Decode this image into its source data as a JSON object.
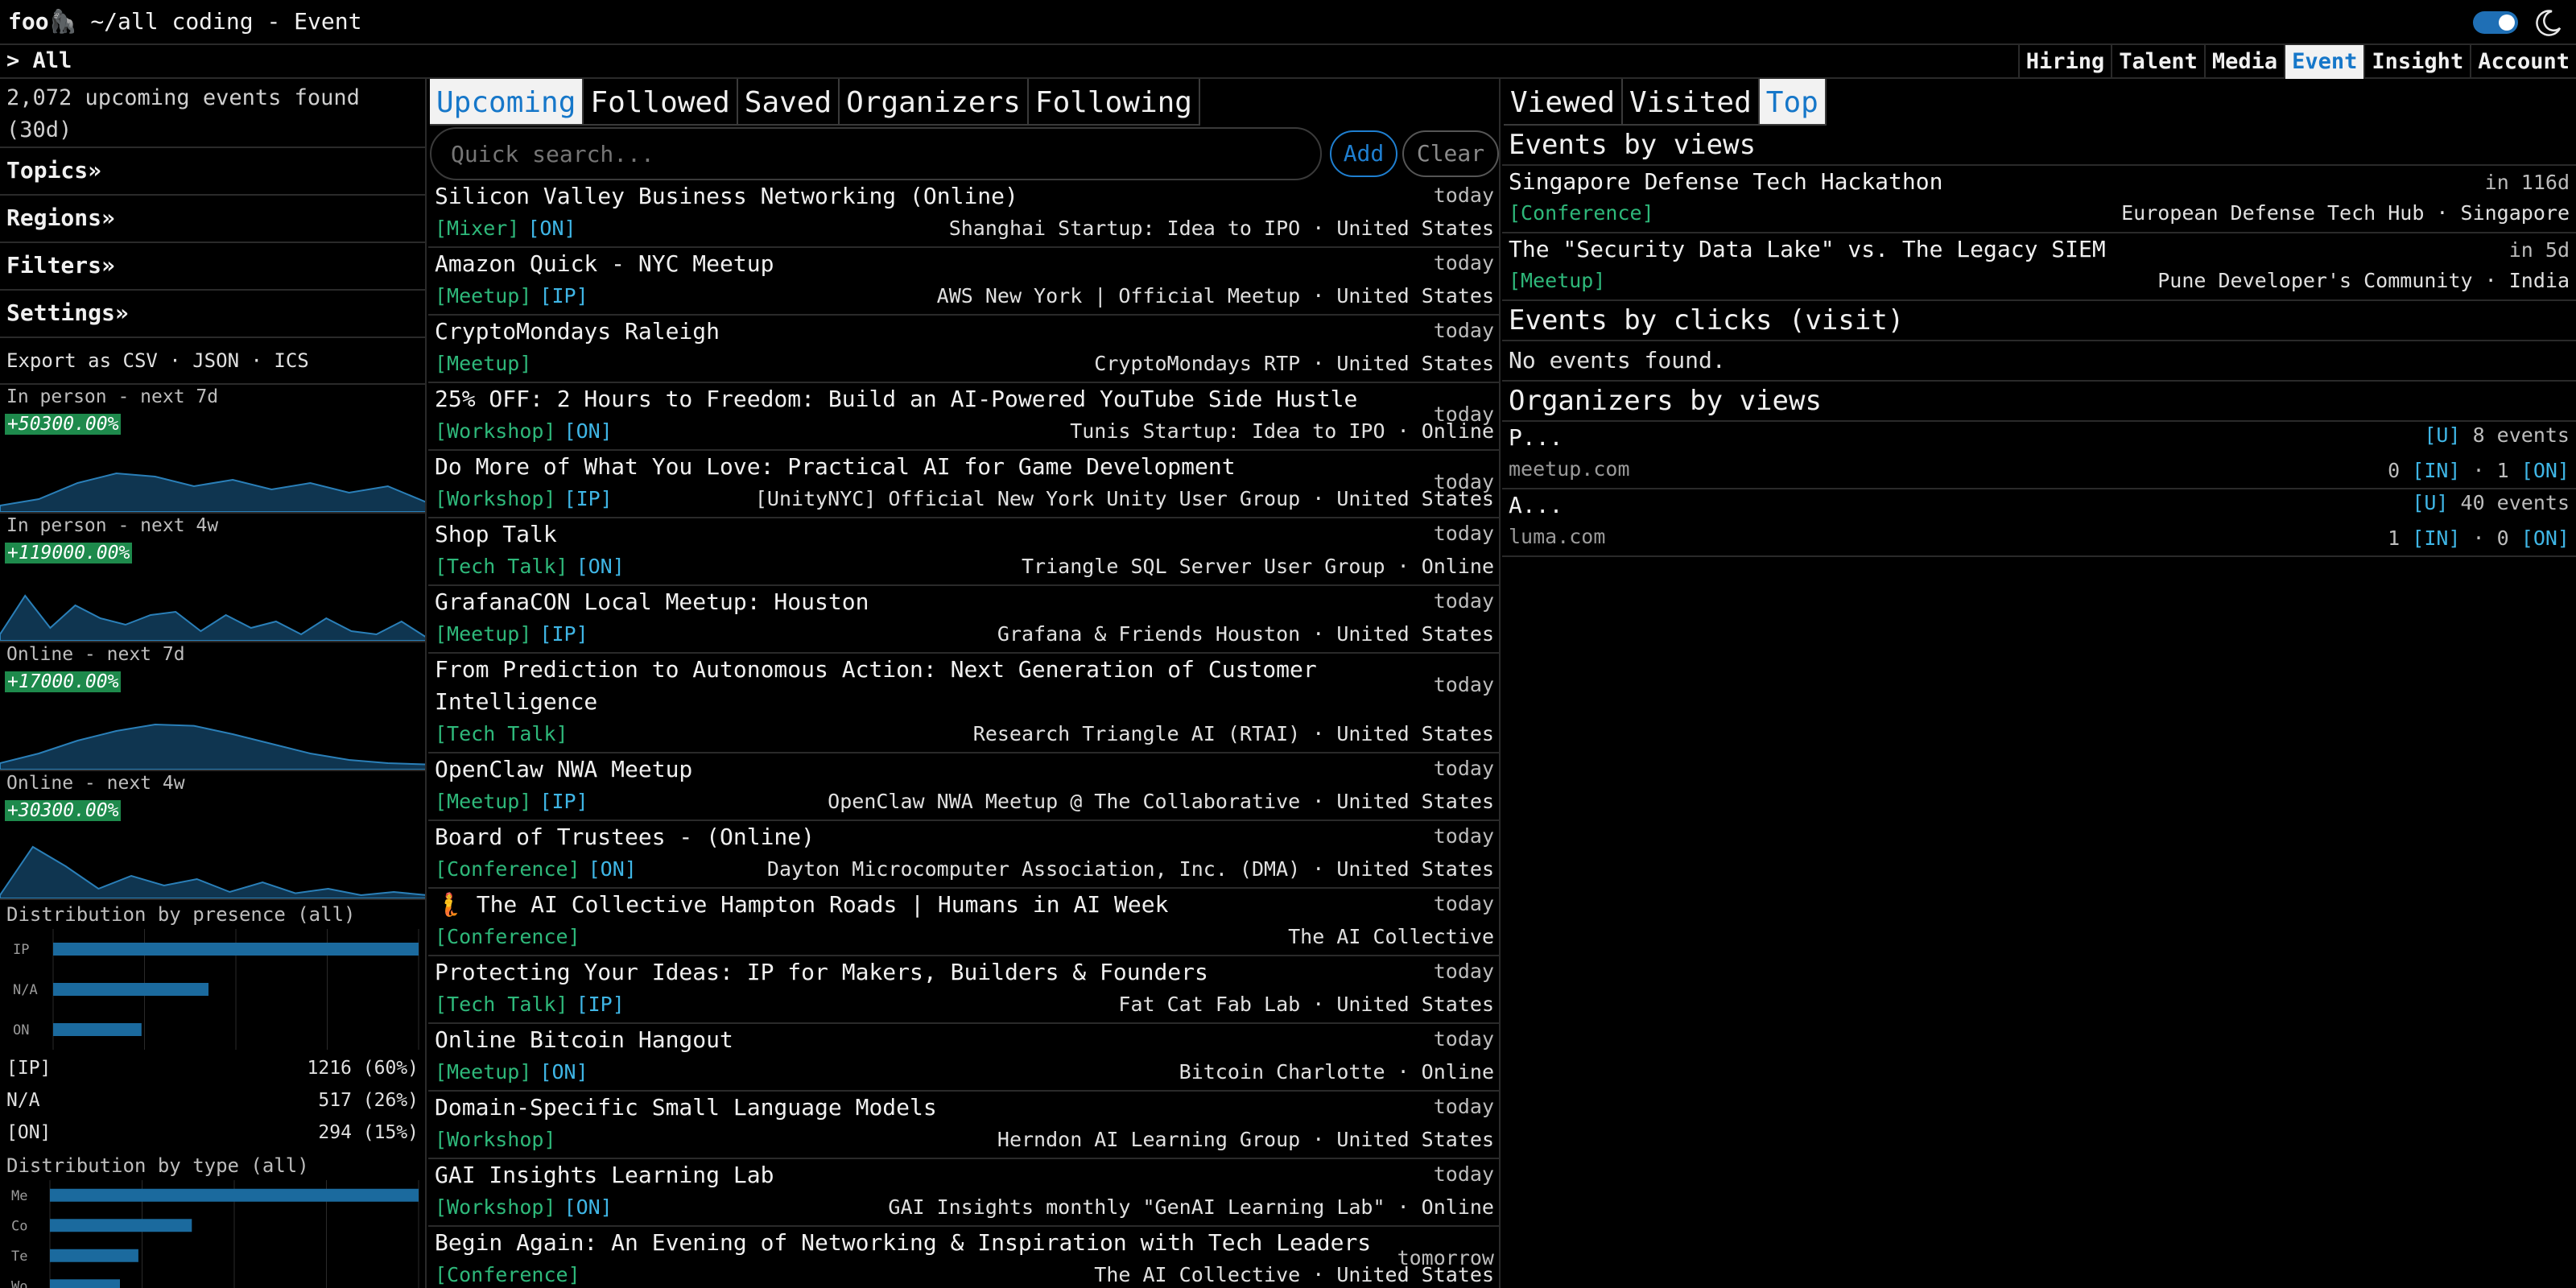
{
  "app": {
    "brand": "foo",
    "brand_emoji": "🦍",
    "title": "~/all coding - Event"
  },
  "crumb": "> All",
  "nav": [
    "Hiring",
    "Talent",
    "Media",
    "Event",
    "Insight",
    "Account"
  ],
  "nav_active": "Event",
  "sidebar": {
    "count_text": "2,072 upcoming events found (30d)",
    "sections": [
      "Topics»",
      "Regions»",
      "Filters»",
      "Settings»"
    ],
    "export": {
      "prefix": "Export as",
      "formats": [
        "CSV",
        "JSON",
        "ICS"
      ],
      "sep": " · "
    },
    "trends": [
      {
        "label": "In person - next 7d",
        "change": "+50300.00%"
      },
      {
        "label": "In person - next 4w",
        "change": "+119000.00%"
      },
      {
        "label": "Online - next 7d",
        "change": "+17000.00%"
      },
      {
        "label": "Online - next 4w",
        "change": "+30300.00%"
      }
    ],
    "dist_presence": {
      "title": "Distribution by presence (all)",
      "chart_data": {
        "type": "bar",
        "categories": [
          "IP",
          "N/A",
          "ON"
        ],
        "values": [
          1216,
          517,
          294
        ]
      },
      "rows": [
        {
          "key": "[IP]",
          "value": "1216 (60%)"
        },
        {
          "key": "N/A",
          "value": "517 (26%)"
        },
        {
          "key": "[ON]",
          "value": "294 (15%)"
        }
      ]
    },
    "dist_type": {
      "title": "Distribution by type (all)",
      "chart_data": {
        "type": "bar",
        "categories": [
          "Me",
          "Co",
          "Te",
          "Wo"
        ],
        "values": [
          1000,
          385,
          240,
          190
        ]
      }
    }
  },
  "middle": {
    "tabs": [
      "Upcoming",
      "Followed",
      "Saved",
      "Organizers",
      "Following"
    ],
    "tab_active": "Upcoming",
    "search": {
      "placeholder": "Quick search..."
    },
    "buttons": {
      "add": "Add",
      "clear": "Clear"
    },
    "events": [
      {
        "title": "Silicon Valley Business Networking (Online)",
        "when": "today",
        "type": "[Mixer]",
        "mode": "[ON]",
        "org": "Shanghai Startup: Idea to IPO · United States"
      },
      {
        "title": "Amazon Quick - NYC Meetup",
        "when": "today",
        "type": "[Meetup]",
        "mode": "[IP]",
        "org": "AWS New York | Official Meetup · United States"
      },
      {
        "title": "CryptoMondays Raleigh",
        "when": "today",
        "type": "[Meetup]",
        "mode": "",
        "org": "CryptoMondays RTP · United States"
      },
      {
        "title": "25% OFF: 2 Hours to Freedom: Build an AI-Powered YouTube Side Hustle",
        "when": "today",
        "type": "[Workshop]",
        "mode": "[ON]",
        "org": "Tunis Startup: Idea to IPO · Online"
      },
      {
        "title": "Do More of What You Love: Practical AI for Game Development",
        "when": "today",
        "type": "[Workshop]",
        "mode": "[IP]",
        "org": "[UnityNYC] Official New York Unity User Group · United States"
      },
      {
        "title": "Shop Talk",
        "when": "today",
        "type": "[Tech Talk]",
        "mode": "[ON]",
        "org": "Triangle SQL Server User Group · Online"
      },
      {
        "title": "GrafanaCON Local Meetup: Houston",
        "when": "today",
        "type": "[Meetup]",
        "mode": "[IP]",
        "org": "Grafana & Friends Houston · United States"
      },
      {
        "title": "From Prediction to Autonomous Action: Next Generation of Customer Intelligence",
        "when": "today",
        "type": "[Tech Talk]",
        "mode": "",
        "org": "Research Triangle AI (RTAI) · United States"
      },
      {
        "title": "OpenClaw NWA Meetup",
        "when": "today",
        "type": "[Meetup]",
        "mode": "[IP]",
        "org": "OpenClaw NWA Meetup @ The Collaborative · United States"
      },
      {
        "title": "Board of Trustees - (Online)",
        "when": "today",
        "type": "[Conference]",
        "mode": "[ON]",
        "org": "Dayton Microcomputer Association, Inc. (DMA) · United States"
      },
      {
        "title": "🧜 The AI Collective Hampton Roads | Humans in AI Week",
        "when": "today",
        "type": "[Conference]",
        "mode": "",
        "org": "The AI Collective"
      },
      {
        "title": "Protecting Your Ideas: IP for Makers, Builders & Founders",
        "when": "today",
        "type": "[Tech Talk]",
        "mode": "[IP]",
        "org": "Fat Cat Fab Lab · United States"
      },
      {
        "title": "Online Bitcoin Hangout",
        "when": "today",
        "type": "[Meetup]",
        "mode": "[ON]",
        "org": "Bitcoin Charlotte · Online"
      },
      {
        "title": "Domain-Specific Small Language Models",
        "when": "today",
        "type": "[Workshop]",
        "mode": "",
        "org": "Herndon AI Learning Group · United States"
      },
      {
        "title": "GAI Insights Learning Lab",
        "when": "today",
        "type": "[Workshop]",
        "mode": "[ON]",
        "org": "GAI Insights monthly \"GenAI Learning Lab\" · Online"
      },
      {
        "title": "Begin Again: An Evening of Networking & Inspiration with Tech Leaders",
        "when": "tomorrow",
        "type": "[Conference]",
        "mode": "",
        "org": "The AI Collective · United States"
      }
    ]
  },
  "right": {
    "tabs": [
      "Viewed",
      "Visited",
      "Top"
    ],
    "tab_active": "Top",
    "by_views_title": "Events by views",
    "by_views": [
      {
        "title": "Singapore Defense Tech Hackathon",
        "when": "in 116d",
        "type": "[Conference]",
        "org": "European Defense Tech Hub · Singapore"
      },
      {
        "title": "The \"Security Data Lake\" vs. The Legacy SIEM",
        "when": "in 5d",
        "type": "[Meetup]",
        "org": "Pune Developer's Community · India"
      }
    ],
    "by_clicks_title": "Events by clicks (visit)",
    "by_clicks_empty": "No events found.",
    "organizers_title": "Organizers by views",
    "organizers": [
      {
        "name": "P...",
        "badge": "[U]",
        "count": "8 events",
        "domain": "meetup.com",
        "in_count": "0",
        "in_tag": "[IN]",
        "on_count": "1",
        "on_tag": "[ON]"
      },
      {
        "name": "A...",
        "badge": "[U]",
        "count": "40 events",
        "domain": "luma.com",
        "in_count": "1",
        "in_tag": "[IN]",
        "on_count": "0",
        "on_tag": "[ON]"
      }
    ]
  },
  "colors": {
    "accent": "#1677c9",
    "type_tag": "#2eb87a",
    "mode_tag": "#3fb6e6",
    "badge": "#1e8a4c",
    "chart": "#1d5f8a"
  }
}
